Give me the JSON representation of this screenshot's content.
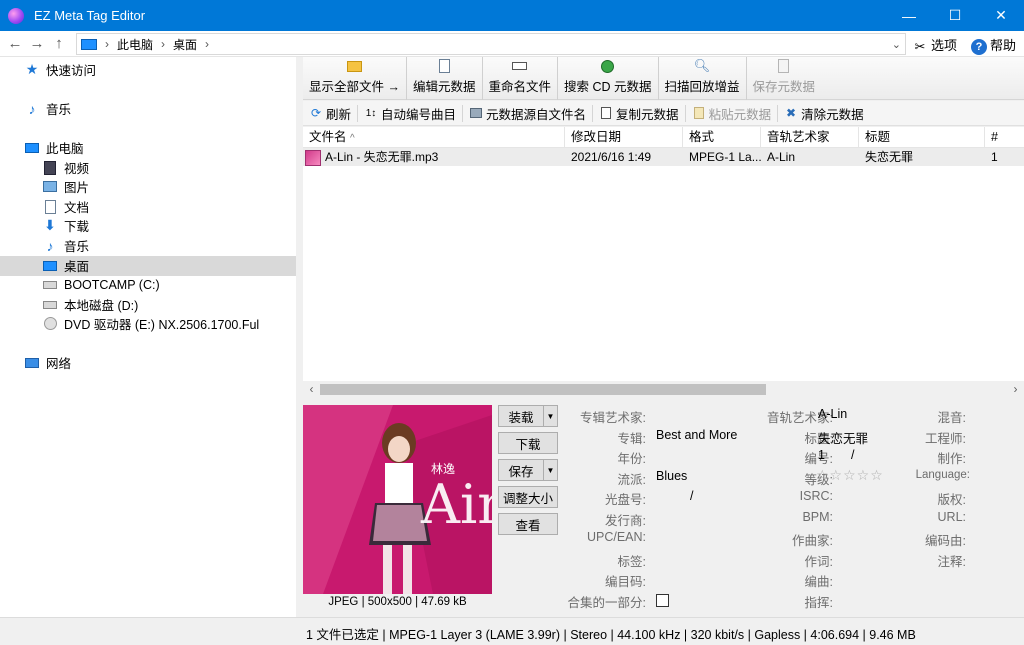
{
  "window": {
    "title": "EZ Meta Tag Editor",
    "min": "—",
    "max": "☐",
    "close": "✕"
  },
  "address": {
    "back": "←",
    "forward": "→",
    "up": "↑",
    "crumbs": [
      "此电脑",
      "桌面"
    ],
    "sep": "›",
    "dropdown": "⌄",
    "options_label": "选项",
    "help_label": "帮助"
  },
  "nav": {
    "quick_access": "快速访问",
    "music_top": "音乐",
    "this_pc": "此电脑",
    "videos": "视频",
    "pictures": "图片",
    "documents": "文档",
    "downloads": "下载",
    "music": "音乐",
    "desktop": "桌面",
    "bootcamp": "BOOTCAMP (C:)",
    "local_disk": "本地磁盘 (D:)",
    "dvd": "DVD 驱动器 (E:) NX.2506.1700.Ful",
    "network": "网络"
  },
  "toolbar1": {
    "show_all": "显示全部文件 →",
    "edit_meta": "编辑元数据",
    "rename": "重命名文件",
    "search_cd": "搜索 CD 元数据",
    "scan_gain": "扫描回放增益",
    "save_meta": "保存元数据"
  },
  "toolbar2": {
    "refresh": "刷新",
    "auto_number": "自动编号曲目",
    "from_filename": "元数据源自文件名",
    "copy": "复制元数据",
    "paste": "粘贴元数据",
    "clear": "清除元数据"
  },
  "list": {
    "columns": [
      "文件名",
      "修改日期",
      "格式",
      "音轨艺术家",
      "标题",
      "#"
    ],
    "sort_indicator": "^",
    "rows": [
      {
        "filename": "A-Lin - 失恋无罪.mp3",
        "modified": "2021/6/16 1:49",
        "format": "MPEG-1 La...",
        "artist": "A-Lin",
        "title": "失恋无罪",
        "num": "1"
      }
    ]
  },
  "artwork": {
    "caption": "JPEG | 500x500 | 47.69 kB",
    "cover_text": "Ain",
    "cover_sub": "林逸",
    "buttons": {
      "load": "装载",
      "download": "下载",
      "save": "保存",
      "resize": "调整大小",
      "view": "查看"
    }
  },
  "tags": {
    "album_artist_lbl": "专辑艺术家:",
    "album_artist": "",
    "album_lbl": "专辑:",
    "album": "Best and More",
    "year_lbl": "年份:",
    "year": "",
    "genre_lbl": "流派:",
    "genre": "Blues",
    "disc_lbl": "光盘号:",
    "disc": "/",
    "publisher_lbl": "发行商:",
    "publisher": "",
    "upc_lbl": "UPC/EAN:",
    "upc": "",
    "label_lbl": "标签:",
    "label": "",
    "catalog_lbl": "编目码:",
    "catalog": "",
    "compilation_lbl": "合集的一部分:",
    "track_artist_lbl": "音轨艺术家:",
    "track_artist": "A-Lin",
    "title_lbl": "标题:",
    "title": "失恋无罪",
    "number_lbl": "编号:",
    "number": "1",
    "number_sep": "/",
    "rating_lbl": "等级:",
    "rating": "☆☆☆☆☆",
    "isrc_lbl": "ISRC:",
    "bpm_lbl": "BPM:",
    "composer_lbl": "作曲家:",
    "lyricist_lbl": "作词:",
    "arranger_lbl": "编曲:",
    "conductor_lbl": "指挥:",
    "mixer_lbl": "混音:",
    "engineer_lbl": "工程师:",
    "producer_lbl": "制作:",
    "language_lbl": "Language:",
    "copyright_lbl": "版权:",
    "url_lbl": "URL:",
    "encoder_lbl": "编码由:",
    "comment_lbl": "注释:"
  },
  "status": "1 文件已选定 | MPEG-1 Layer 3 (LAME 3.99r) | Stereo | 44.100 kHz | 320 kbit/s | Gapless | 4:06.694 | 9.46 MB"
}
